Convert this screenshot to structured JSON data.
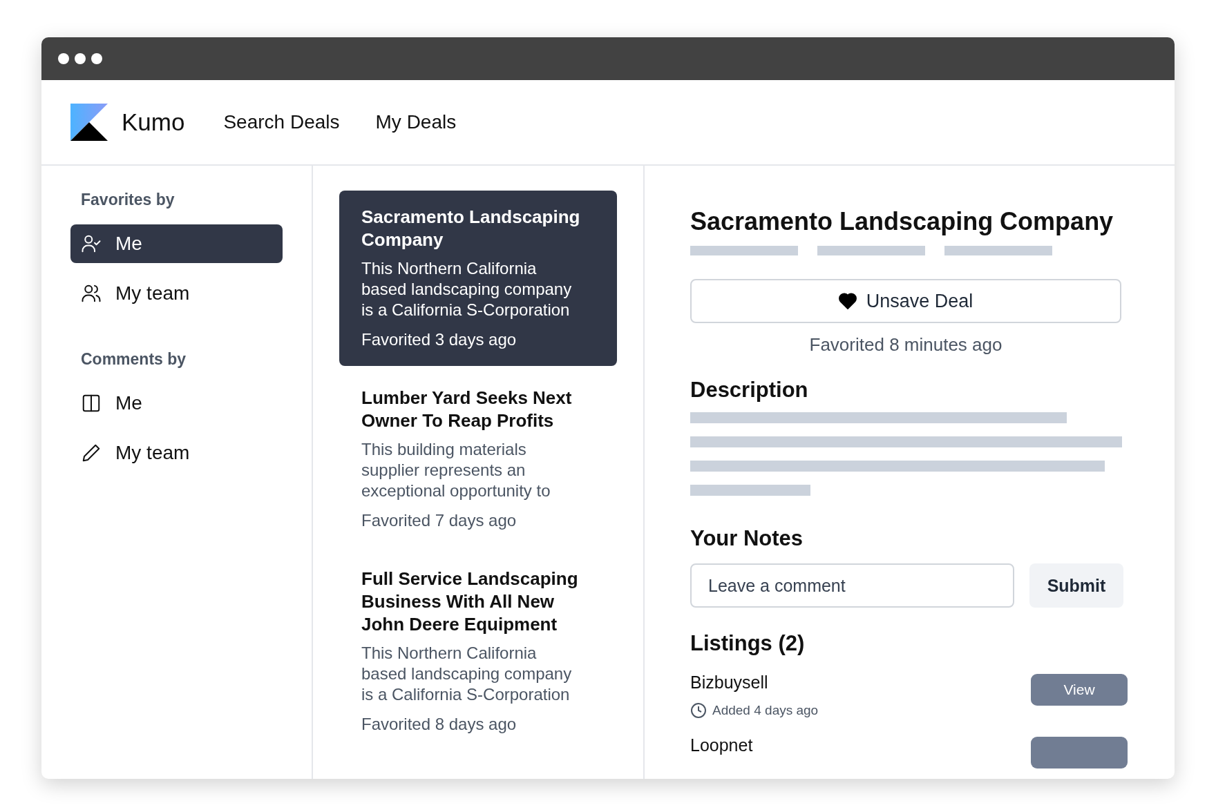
{
  "header": {
    "brand": "Kumo",
    "nav": [
      {
        "label": "Search Deals",
        "selected": false
      },
      {
        "label": "My Deals",
        "selected": false
      }
    ]
  },
  "sidebar": {
    "sections": [
      {
        "heading": "Favorites by",
        "items": [
          {
            "label": "Me",
            "selected": true
          },
          {
            "label": "My team",
            "selected": false
          }
        ]
      },
      {
        "heading": "Comments by",
        "items": [
          {
            "label": "Me",
            "selected": false
          },
          {
            "label": "My team",
            "selected": false
          }
        ]
      }
    ]
  },
  "deals": [
    {
      "title": "Sacramento Landscaping Company",
      "description": "This Northern California based landscaping company is a California S-Corporation",
      "favorited": "Favorited 3 days ago",
      "selected": true
    },
    {
      "title": "Lumber Yard Seeks Next Owner To Reap Profits",
      "description": "This building materials supplier represents an exceptional opportunity to",
      "favorited": "Favorited 7 days ago",
      "selected": false
    },
    {
      "title": "Full Service Landscaping Business With All New John Deere Equipment",
      "description": "This Northern California based landscaping company is a California S-Corporation",
      "favorited": "Favorited 8 days ago",
      "selected": false
    }
  ],
  "detail": {
    "title": "Sacramento Landscaping Company",
    "save_button": {
      "label": "Unsave Deal",
      "saved": true
    },
    "favorited": "Favorited 8 minutes ago",
    "description_heading": "Description",
    "notes_heading": "Your Notes",
    "comment": {
      "placeholder": "Leave a comment"
    },
    "submit": "Submit",
    "listings_heading": "Listings (2)",
    "listings": [
      {
        "name": "Bizbuysell",
        "added": "Added 4 days ago",
        "button": "View"
      },
      {
        "name": "Loopnet"
      }
    ]
  }
}
